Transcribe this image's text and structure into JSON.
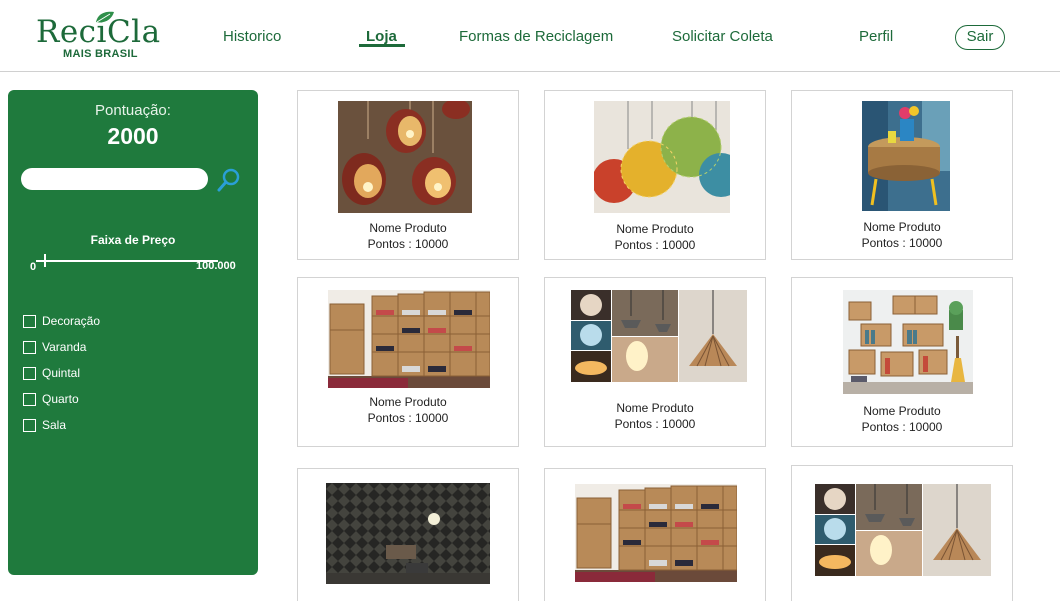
{
  "logo": {
    "word": "ReciCla",
    "sub": "MAIS BRASIL"
  },
  "nav": {
    "items": [
      {
        "label": "Historico",
        "active": false
      },
      {
        "label": "Loja",
        "active": true
      },
      {
        "label": "Formas de Reciclagem",
        "active": false
      },
      {
        "label": "Solicitar Coleta",
        "active": false
      },
      {
        "label": "Perfil",
        "active": false
      }
    ],
    "logout": "Sair"
  },
  "sidebar": {
    "score_label": "Pontuação:",
    "score_value": "2000",
    "search": {
      "value": "",
      "placeholder": ""
    },
    "price_range": {
      "title": "Faixa de Preço",
      "min_label": "0",
      "max_label": "100.000",
      "handle_value": 0
    },
    "categories": [
      {
        "label": "Decoração",
        "checked": false
      },
      {
        "label": "Varanda",
        "checked": false
      },
      {
        "label": "Quintal",
        "checked": false
      },
      {
        "label": "Quarto",
        "checked": false
      },
      {
        "label": "Sala",
        "checked": false
      }
    ]
  },
  "products": [
    {
      "name": "Nome Produto",
      "points": "Pontos : 10000",
      "image": "candle-lanterns"
    },
    {
      "name": "Nome Produto",
      "points": "Pontos : 10000",
      "image": "yarn-pendant-lamps"
    },
    {
      "name": "Nome Produto",
      "points": "Pontos : 10000",
      "image": "tire-side-table"
    },
    {
      "name": "Nome Produto",
      "points": "Pontos : 10000",
      "image": "crate-shoe-shelves"
    },
    {
      "name": "Nome Produto",
      "points": "Pontos : 10000",
      "image": "pendant-lamp-collage"
    },
    {
      "name": "Nome Produto",
      "points": "Pontos : 10000",
      "image": "crate-bookshelf"
    },
    {
      "name": "",
      "points": "",
      "image": "pattern-shadow-lamp"
    },
    {
      "name": "",
      "points": "",
      "image": "crate-shoe-shelves"
    },
    {
      "name": "",
      "points": "",
      "image": "pendant-lamp-collage"
    }
  ],
  "colors": {
    "brand_green": "#1f7a3d",
    "text_green": "#1d6a3a",
    "search_icon": "#2a9fd6"
  }
}
